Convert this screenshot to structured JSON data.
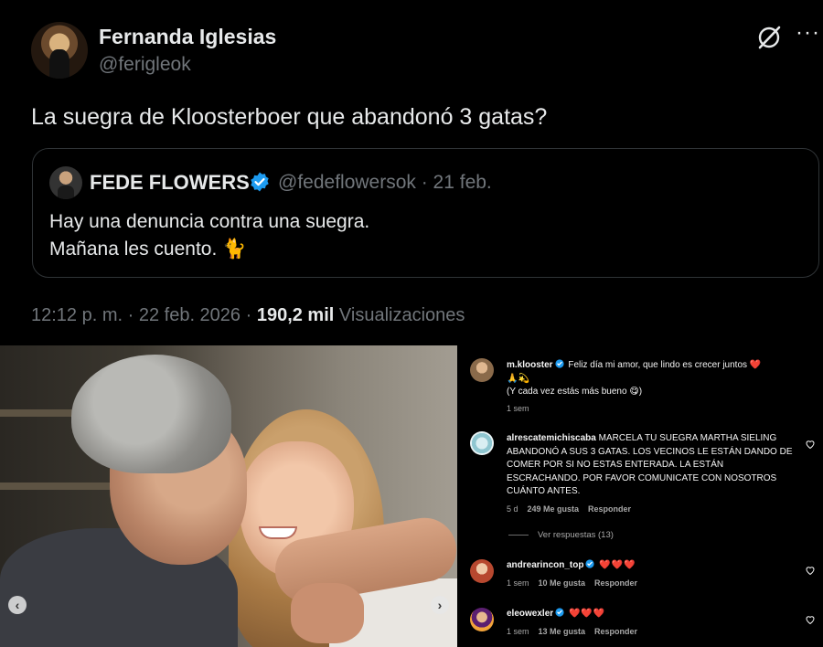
{
  "tweet": {
    "author_name": "Fernanda Iglesias",
    "author_handle": "@ferigleok",
    "text": "La suegra de Kloosterboer que abandonó 3 gatas?",
    "more_label": "···",
    "quoted": {
      "name": "FEDE FLOWERS",
      "handle_date": "@fedeflowersok · 21 feb.",
      "line1": "Hay una denuncia contra una suegra.",
      "line2": "Mañana les cuento. 🐈"
    },
    "meta_time": "12:12 p. m. · 22 feb. 2026 · ",
    "meta_views": "190,2 mil",
    "meta_views_label": " Visualizaciones"
  },
  "photo": {
    "prev_label": "‹",
    "next_label": "›"
  },
  "comments": [
    {
      "user": "m.klooster",
      "verified": true,
      "text_main": "Feliz día mi amor, que lindo es crecer juntos ❤️",
      "text_emoji": "🙏💫",
      "text_line3": "(Y cada vez estás más bueno 😋)",
      "time": "1 sem"
    },
    {
      "user": "alrescatemichiscaba",
      "text": "MARCELA TU SUEGRA MARTHA SIELING ABANDONÓ A SUS 3 GATAS. LOS VECINOS LE ESTÁN DANDO DE COMER POR SI NO ESTAS ENTERADA. LA ESTÁN ESCRACHANDO. POR FAVOR COMUNICATE CON NOSOTROS CUÁNTO ANTES.",
      "time": "5 d",
      "likes": "249 Me gusta",
      "reply": "Responder",
      "view_replies": "Ver respuestas (13)"
    },
    {
      "user": "andrearincon_top",
      "verified": true,
      "text": "❤️❤️❤️",
      "time": "1 sem",
      "likes": "10 Me gusta",
      "reply": "Responder"
    },
    {
      "user": "eleowexler",
      "verified": true,
      "text": "❤️❤️❤️",
      "time": "1 sem",
      "likes": "13 Me gusta",
      "reply": "Responder"
    }
  ],
  "colors": {
    "background": "#000000",
    "muted": "#71767b",
    "verified_blue": "#1d9bf0",
    "heart_red": "#ff3040"
  }
}
